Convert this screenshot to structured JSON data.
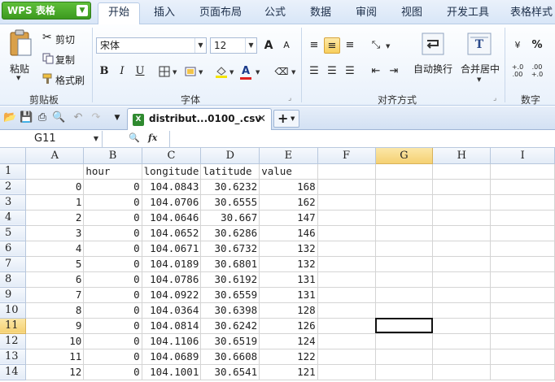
{
  "app": {
    "button_label": "WPS 表格"
  },
  "menu": {
    "tabs": [
      "开始",
      "插入",
      "页面布局",
      "公式",
      "数据",
      "审阅",
      "视图",
      "开发工具",
      "表格样式"
    ],
    "active_index": 0
  },
  "ribbon": {
    "clipboard": {
      "paste_label": "粘贴",
      "cut_label": "剪切",
      "copy_label": "复制",
      "format_painter_label": "格式刷",
      "group_label": "剪贴板"
    },
    "font": {
      "font_name": "宋体",
      "font_size": "12",
      "grow_label": "A",
      "shrink_label": "A",
      "bold": "B",
      "italic": "I",
      "underline": "U",
      "group_label": "字体"
    },
    "alignment": {
      "wrap_label": "自动换行",
      "merge_label": "合并居中",
      "group_label": "对齐方式"
    },
    "number": {
      "percent_label": "%",
      "group_label": "数字"
    },
    "colors": {
      "fill_color": "#f5e400",
      "font_color": "#e02020"
    }
  },
  "document_tab": {
    "name": "distribut...0100_.csv",
    "icon_letter": "X"
  },
  "formula_bar": {
    "cell_ref": "G11",
    "fx_label": "fx",
    "value": ""
  },
  "sheet": {
    "columns": [
      "A",
      "B",
      "C",
      "D",
      "E",
      "F",
      "G",
      "H",
      "I"
    ],
    "active_column": "G",
    "active_row": 11,
    "rows": [
      {
        "n": 1,
        "cells": [
          "",
          "hour",
          "longitude",
          "latitude",
          "value"
        ]
      },
      {
        "n": 2,
        "cells": [
          "0",
          "0",
          "104.0843",
          "30.6232",
          "168"
        ]
      },
      {
        "n": 3,
        "cells": [
          "1",
          "0",
          "104.0706",
          "30.6555",
          "162"
        ]
      },
      {
        "n": 4,
        "cells": [
          "2",
          "0",
          "104.0646",
          "30.667",
          "147"
        ]
      },
      {
        "n": 5,
        "cells": [
          "3",
          "0",
          "104.0652",
          "30.6286",
          "146"
        ]
      },
      {
        "n": 6,
        "cells": [
          "4",
          "0",
          "104.0671",
          "30.6732",
          "132"
        ]
      },
      {
        "n": 7,
        "cells": [
          "5",
          "0",
          "104.0189",
          "30.6801",
          "132"
        ]
      },
      {
        "n": 8,
        "cells": [
          "6",
          "0",
          "104.0786",
          "30.6192",
          "131"
        ]
      },
      {
        "n": 9,
        "cells": [
          "7",
          "0",
          "104.0922",
          "30.6559",
          "131"
        ]
      },
      {
        "n": 10,
        "cells": [
          "8",
          "0",
          "104.0364",
          "30.6398",
          "128"
        ]
      },
      {
        "n": 11,
        "cells": [
          "9",
          "0",
          "104.0814",
          "30.6242",
          "126"
        ]
      },
      {
        "n": 12,
        "cells": [
          "10",
          "0",
          "104.1106",
          "30.6519",
          "124"
        ]
      },
      {
        "n": 13,
        "cells": [
          "11",
          "0",
          "104.0689",
          "30.6608",
          "122"
        ]
      },
      {
        "n": 14,
        "cells": [
          "12",
          "0",
          "104.1001",
          "30.6541",
          "121"
        ]
      }
    ]
  }
}
